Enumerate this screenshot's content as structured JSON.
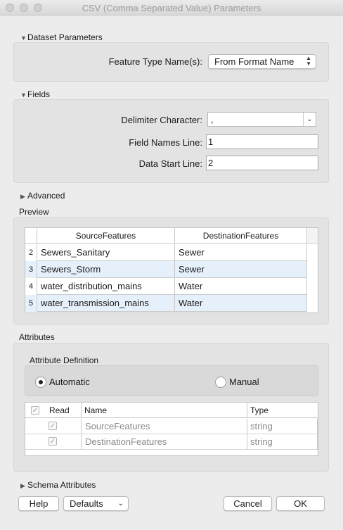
{
  "window": {
    "title": "CSV (Comma Separated Value) Parameters"
  },
  "dataset": {
    "header": "Dataset Parameters",
    "feature_type_label": "Feature Type Name(s):",
    "feature_type_value": "From Format Name"
  },
  "fields": {
    "header": "Fields",
    "delimiter_label": "Delimiter Character:",
    "delimiter_value": ",",
    "field_names_label": "Field Names Line:",
    "field_names_value": "1",
    "data_start_label": "Data Start Line:",
    "data_start_value": "2"
  },
  "advanced": {
    "header": "Advanced"
  },
  "preview": {
    "header": "Preview",
    "columns": [
      "SourceFeatures",
      "DestinationFeatures"
    ],
    "rows": [
      {
        "num": "2",
        "source": "Sewers_Sanitary",
        "dest": "Sewer"
      },
      {
        "num": "3",
        "source": "Sewers_Storm",
        "dest": "Sewer"
      },
      {
        "num": "4",
        "source": "water_distribution_mains",
        "dest": "Water"
      },
      {
        "num": "5",
        "source": "water_transmission_mains",
        "dest": "Water"
      }
    ]
  },
  "attributes": {
    "header": "Attributes",
    "definition_label": "Attribute Definition",
    "option_automatic": "Automatic",
    "option_manual": "Manual",
    "selected": "Automatic",
    "columns": {
      "read": "Read",
      "name": "Name",
      "type": "Type"
    },
    "rows": [
      {
        "checked": true,
        "name": "SourceFeatures",
        "type": "string"
      },
      {
        "checked": true,
        "name": "DestinationFeatures",
        "type": "string"
      }
    ]
  },
  "schema": {
    "header": "Schema Attributes"
  },
  "buttons": {
    "help": "Help",
    "defaults": "Defaults",
    "cancel": "Cancel",
    "ok": "OK"
  },
  "icons": {
    "expanded": "triangle-down-icon",
    "collapsed": "triangle-right-icon",
    "check": "check-icon"
  }
}
